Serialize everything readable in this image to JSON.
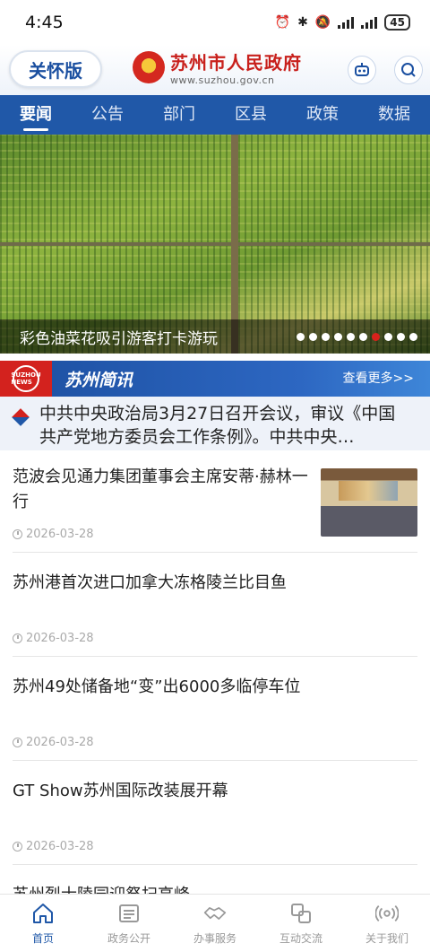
{
  "status_bar": {
    "time": "4:45",
    "battery": "45"
  },
  "header": {
    "care_mode_label": "关怀版",
    "site_title": "苏州市人民政府",
    "site_url": "www.suzhou.gov.cn",
    "robot_icon": "robot-icon",
    "search_icon": "search-icon"
  },
  "nav": {
    "tabs": [
      {
        "label": "要闻",
        "active": true
      },
      {
        "label": "公告",
        "active": false
      },
      {
        "label": "部门",
        "active": false
      },
      {
        "label": "区县",
        "active": false
      },
      {
        "label": "政策",
        "active": false
      },
      {
        "label": "数据",
        "active": false
      }
    ]
  },
  "banner": {
    "caption": "彩色油菜花吸引游客打卡游玩",
    "slide_count": 10,
    "active_slide": 6
  },
  "brief": {
    "logo_text": "SUZHOU NEWS",
    "title": "苏州简讯",
    "more_label": "查看更多>>",
    "text": "中共中央政治局3月27日召开会议，审议《中国共产党地方委员会工作条例》。中共中央…"
  },
  "news": [
    {
      "title": "范波会见通力集团董事会主席安蒂·赫林一行",
      "date": "2026-03-28",
      "has_thumb": true
    },
    {
      "title": "苏州港首次进口加拿大冻格陵兰比目鱼",
      "date": "2026-03-28",
      "has_thumb": false
    },
    {
      "title": "苏州49处储备地“变”出6000多临停车位",
      "date": "2026-03-28",
      "has_thumb": false
    },
    {
      "title": "GT Show苏州国际改装展开幕",
      "date": "2026-03-28",
      "has_thumb": false
    },
    {
      "title": "苏州烈士陵园迎祭扫高峰",
      "date": "",
      "has_thumb": false
    }
  ],
  "bottom_nav": {
    "items": [
      {
        "label": "首页",
        "icon": "home-icon",
        "active": true
      },
      {
        "label": "政务公开",
        "icon": "document-icon",
        "active": false
      },
      {
        "label": "办事服务",
        "icon": "handshake-icon",
        "active": false
      },
      {
        "label": "互动交流",
        "icon": "exchange-icon",
        "active": false
      },
      {
        "label": "关于我们",
        "icon": "broadcast-icon",
        "active": false
      }
    ]
  },
  "colors": {
    "brand_blue": "#2058a8",
    "brand_red": "#c8201c"
  }
}
